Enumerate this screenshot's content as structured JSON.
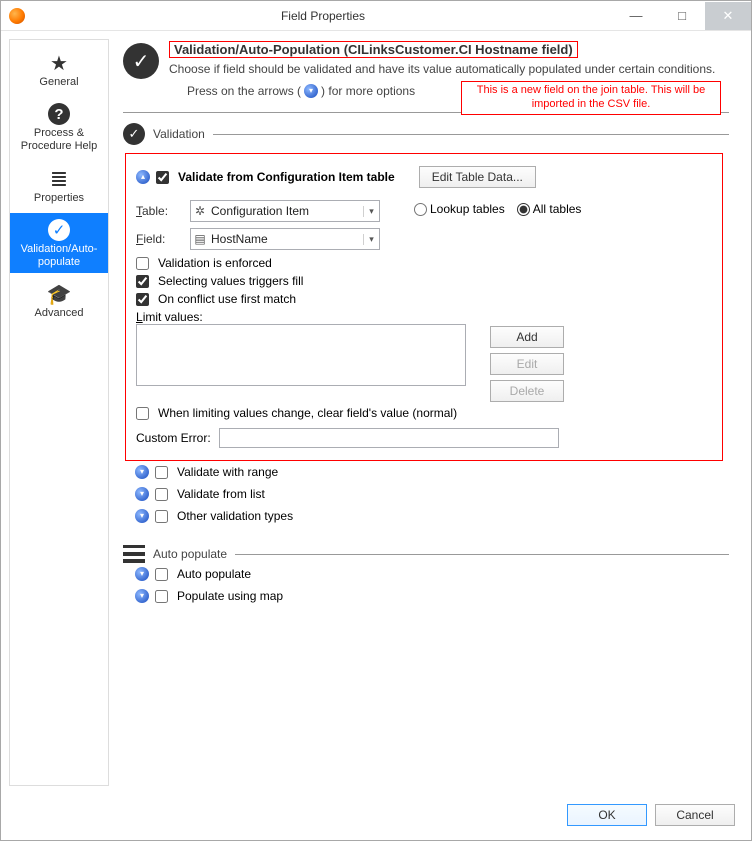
{
  "window": {
    "title": "Field Properties",
    "min": "—",
    "max": "□",
    "close": "✕"
  },
  "sidebar": {
    "items": [
      {
        "label": "General",
        "glyph": "★"
      },
      {
        "label": "Process & Procedure Help",
        "glyph": "?"
      },
      {
        "label": "Properties",
        "glyph": "≣"
      },
      {
        "label": "Validation/Auto-populate",
        "glyph": "✓"
      },
      {
        "label": "Advanced",
        "glyph": "🎓"
      }
    ]
  },
  "header": {
    "title": "Validation/Auto-Population (CILinksCustomer.CI Hostname field)",
    "subtitle": "Choose if field should be validated and have its value automatically populated under certain conditions.",
    "press_pre": "Press on the arrows (",
    "press_post": ") for more options",
    "annotation": "This is a new field on the join table. This will be imported in the CSV file."
  },
  "validation": {
    "section_label": "Validation",
    "validate_from_label": "Validate from Configuration Item table",
    "edit_table_data": "Edit Table Data...",
    "table_label": "Table:",
    "table_value": "Configuration Item",
    "field_label": "Field:",
    "field_value": "HostName",
    "lookup_tables": "Lookup tables",
    "all_tables": "All tables",
    "enforced": "Validation is enforced",
    "triggers_fill": "Selecting values triggers fill",
    "first_match": "On conflict use first match",
    "limit_values": "Limit values:",
    "add": "Add",
    "edit": "Edit",
    "delete": "Delete",
    "when_limiting": "When limiting values change, clear field's value (normal)",
    "custom_error": "Custom Error:",
    "validate_range": "Validate with range",
    "validate_list": "Validate from list",
    "other_validation": "Other validation types"
  },
  "autopop": {
    "section_label": "Auto populate",
    "auto_populate": "Auto populate",
    "populate_map": "Populate using map"
  },
  "footer": {
    "ok": "OK",
    "cancel": "Cancel"
  }
}
